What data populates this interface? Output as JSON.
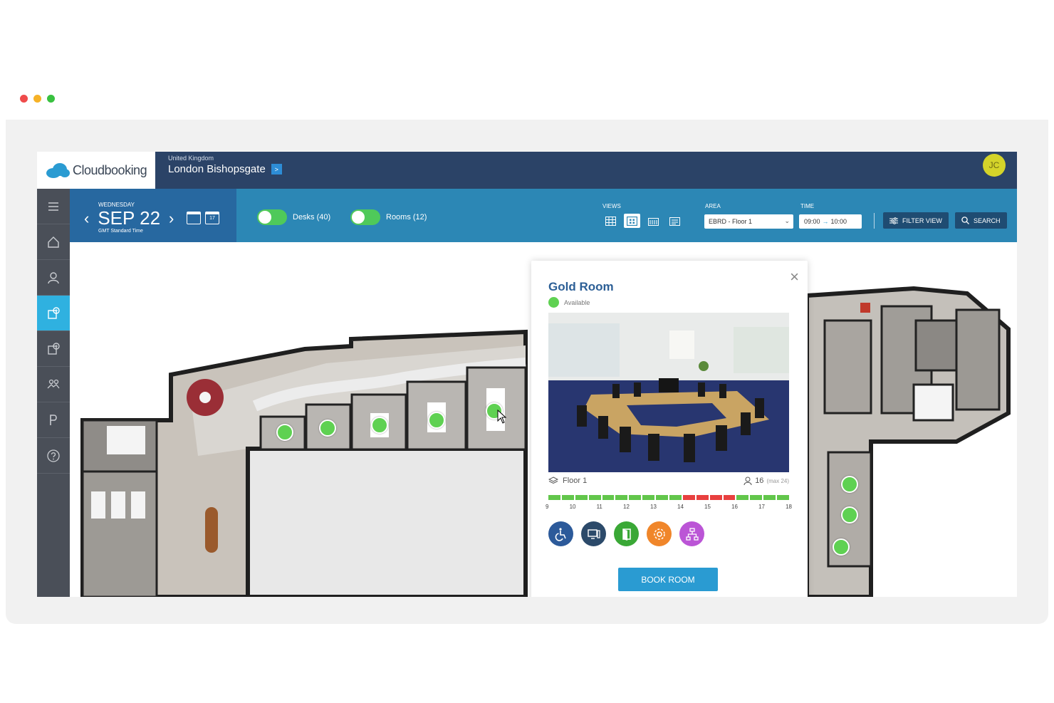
{
  "window": {
    "dots": [
      "#ef4b4b",
      "#f6b228",
      "#39c140"
    ]
  },
  "header": {
    "logo_text": "Cloudbooking",
    "country": "United Kingdom",
    "location": "London Bishopsgate",
    "location_arrow": ">",
    "avatar_initials": "JC"
  },
  "sidebar": {
    "items": [
      {
        "name": "menu-icon"
      },
      {
        "name": "home-icon"
      },
      {
        "name": "user-icon"
      },
      {
        "name": "room-booking-icon",
        "active": true
      },
      {
        "name": "desk-booking-icon"
      },
      {
        "name": "people-icon"
      },
      {
        "name": "parking-icon"
      },
      {
        "name": "help-icon"
      }
    ]
  },
  "toolbar": {
    "day_of_week": "WEDNESDAY",
    "date": "SEP 22",
    "prev": "‹",
    "next": "›",
    "timezone": "GMT Standard Time",
    "calendar_day": "17",
    "desks_toggle": "Desks (40)",
    "rooms_toggle": "Rooms (12)",
    "views_label": "VIEWS",
    "area_label": "AREA",
    "area_value": "EBRD - Floor 1",
    "time_label": "TIME",
    "time_from": "09:00",
    "time_arrow": "→",
    "time_to": "10:00",
    "filter_view": "FILTER VIEW",
    "search": "SEARCH"
  },
  "room_card": {
    "title": "Gold Room",
    "status": "Available",
    "floor": "Floor 1",
    "capacity": "16",
    "capacity_max": "(max 24)",
    "close": "×",
    "timeline_hours": [
      "9",
      "10",
      "11",
      "12",
      "13",
      "14",
      "15",
      "16",
      "17",
      "18"
    ],
    "timeline_slots": [
      "free",
      "free",
      "free",
      "free",
      "free",
      "free",
      "free",
      "free",
      "free",
      "free",
      "busy",
      "busy",
      "busy",
      "busy",
      "free",
      "free",
      "free",
      "free"
    ],
    "slot_colors": {
      "free": "#62c64b",
      "busy": "#e8403f"
    },
    "amenities": [
      {
        "name": "wheelchair-icon",
        "color": "#2c5a9a"
      },
      {
        "name": "display-icon",
        "color": "#2c4a6a"
      },
      {
        "name": "door-icon",
        "color": "#3aa836"
      },
      {
        "name": "settings-icon",
        "color": "#f0862a"
      },
      {
        "name": "network-icon",
        "color": "#bb55d6"
      }
    ],
    "book_label": "BOOK ROOM"
  }
}
